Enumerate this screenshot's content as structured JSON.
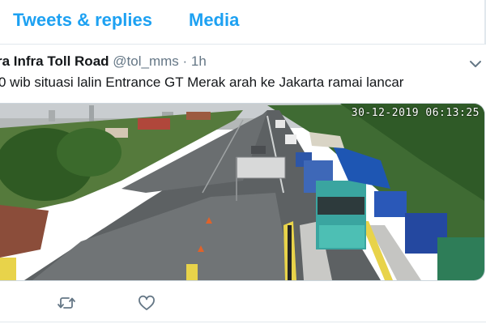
{
  "tabs": {
    "replies": "Tweets & replies",
    "media": "Media"
  },
  "tweet": {
    "author_name": "ra Infra Toll Road",
    "handle": "@tol_mms",
    "separator": "·",
    "time": "1h",
    "text": "0 wib situasi lalin Entrance GT Merak arah ke Jakarta ramai lancar"
  },
  "media": {
    "timestamp": "30-12-2019 06:13:25"
  },
  "icons": {
    "menu": "chevron-down-icon",
    "retweet": "retweet-icon",
    "like": "heart-icon"
  },
  "colors": {
    "accent": "#1da1f2",
    "text": "#14171a",
    "muted": "#657786",
    "border": "#e1e8ed"
  }
}
